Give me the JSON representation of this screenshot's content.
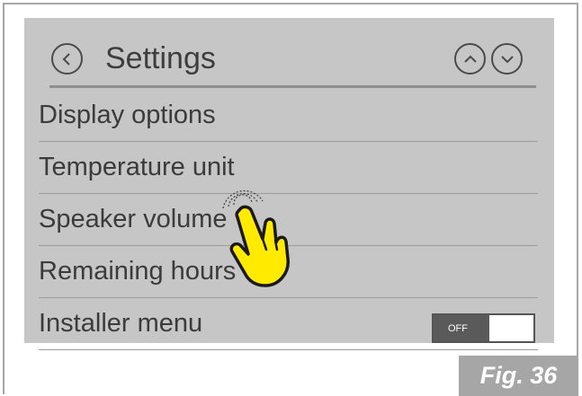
{
  "header": {
    "title": "Settings"
  },
  "menu": {
    "items": [
      {
        "label": "Display options"
      },
      {
        "label": "Temperature unit"
      },
      {
        "label": "Speaker volume"
      },
      {
        "label": "Remaining hours"
      },
      {
        "label": "Installer menu"
      }
    ],
    "installer_toggle": {
      "label": "OFF",
      "state": "off"
    }
  },
  "figure": {
    "label": "Fig. 36"
  },
  "icons": [
    "chevron-left-icon",
    "chevron-up-icon",
    "chevron-down-icon",
    "touch-hand-icon"
  ],
  "colors": {
    "screen_bg": "#c6c6c6",
    "hand_fill": "#ffea00",
    "figure_label_bg": "#a6a6a6"
  }
}
